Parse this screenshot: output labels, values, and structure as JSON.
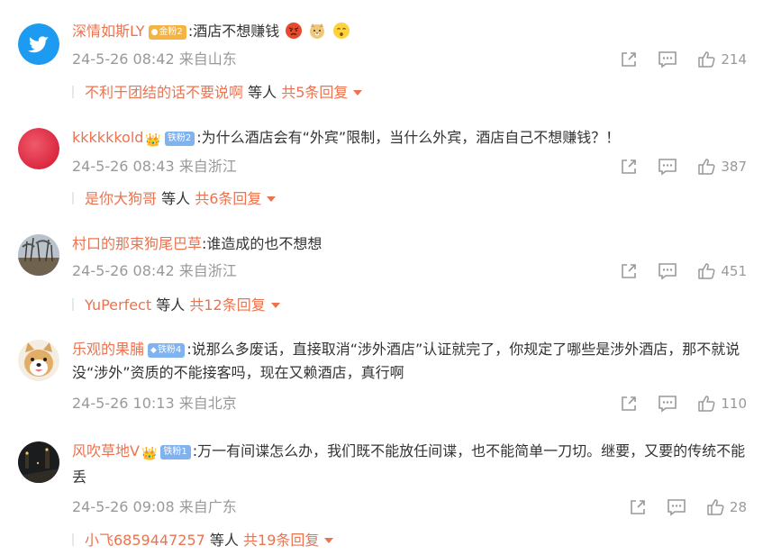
{
  "comments": [
    {
      "username": "深情如斯LY",
      "badge": "金粉2",
      "text": ":酒店不想赚钱",
      "time": "24-5-26 08:42",
      "location": "来自山东",
      "likes": "214",
      "replies": {
        "name": "不利于团结的话不要说啊",
        "middle": "等人",
        "count": "共5条回复"
      }
    },
    {
      "username": "kkkkkkold",
      "badge": "铁粉2",
      "text": ":为什么酒店会有“外宾”限制，当什么外宾，酒店自己不想赚钱？！",
      "time": "24-5-26 08:43",
      "location": "来自浙江",
      "likes": "387",
      "replies": {
        "name": "是你大狗哥",
        "middle": "等人",
        "count": "共6条回复"
      }
    },
    {
      "username": "村口的那束狗尾巴草",
      "text": ":谁造成的也不想想",
      "time": "24-5-26 08:42",
      "location": "来自浙江",
      "likes": "451",
      "replies": {
        "name": "YuPerfect",
        "middle": "等人",
        "count": "共12条回复"
      }
    },
    {
      "username": "乐观的果脯",
      "badge": "铁粉4",
      "text": ":说那么多废话，直接取消“涉外酒店”认证就完了，你规定了哪些是涉外酒店，那不就说没“涉外”资质的不能接客吗，现在又赖酒店，真行啊",
      "time": "24-5-26 10:13",
      "location": "来自北京",
      "likes": "110"
    },
    {
      "username": "风吹草地V",
      "badge": "铁粉1",
      "text": ":万一有间谍怎么办，我们既不能放任间谍，也不能简单一刀切。继要，又要的传统不能丢",
      "time": "24-5-26 09:08",
      "location": "来自广东",
      "likes": "28",
      "replies": {
        "name": "小飞6859447257",
        "middle": "等人",
        "count": "共19条回复"
      }
    }
  ],
  "icons": {
    "share": "share-icon",
    "comment": "comment-icon",
    "like": "thumbs-up-icon",
    "expand": "caret-down-icon"
  },
  "colors": {
    "accent": "#eb7350",
    "muted": "#999999",
    "text": "#333333",
    "fan_gold": "#f5b441",
    "fan_blue": "#7fb2ee",
    "twitter_blue": "#1d9bf0"
  }
}
